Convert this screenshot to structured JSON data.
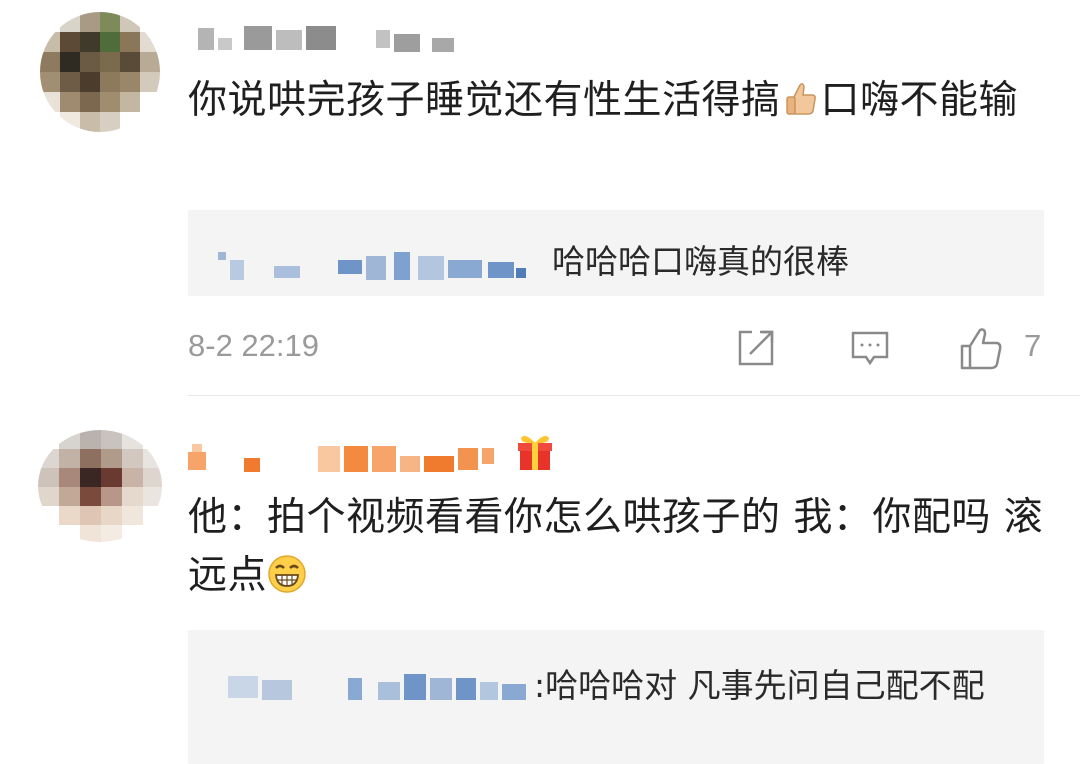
{
  "comments": [
    {
      "text_line": "你说哄完孩子睡觉还有性生活得搞",
      "text_after_emoji": "口嗨不能输",
      "emoji": "thumbs-up-icon",
      "reply": {
        "text": "哈哈哈口嗨真的很棒"
      },
      "meta": {
        "timestamp": "8-2 22:19",
        "like_count": "7"
      }
    },
    {
      "text_line": "他：拍个视频看看你怎么哄孩子的 我：你配吗 滚远点",
      "emoji": "grinning-face-icon",
      "badge": "gift-icon",
      "reply": {
        "text": ":哈哈哈对  凡事先问自己配不配"
      }
    }
  ],
  "colors": {
    "text": "#1f1f1f",
    "meta": "#9a9a9a",
    "reply_bg": "#f4f4f4",
    "username_orange": "#f08a3a",
    "username_blue": "#6f95c8"
  }
}
